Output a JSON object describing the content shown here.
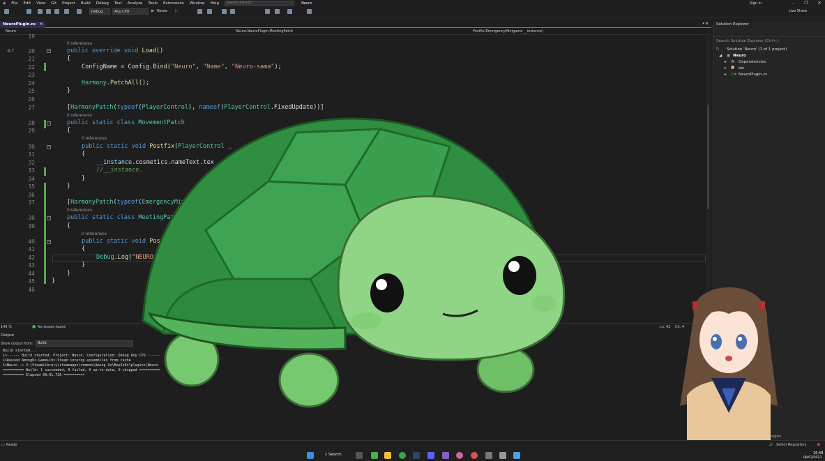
{
  "menubar": {
    "items": [
      "File",
      "Edit",
      "View",
      "Git",
      "Project",
      "Build",
      "Debug",
      "Test",
      "Analyze",
      "Tools",
      "Extensions",
      "Window",
      "Help"
    ],
    "search_placeholder": "Search (Ctrl+Q)",
    "solution_name": "Neuro",
    "sign_in": "Sign in"
  },
  "toolbar": {
    "config": "Debug",
    "platform": "Any CPU",
    "run_label": "Neuro",
    "live_share": "Live Share"
  },
  "document_tab": {
    "label": "NeuroPlugin.cs"
  },
  "navbar": {
    "project": "Neuro",
    "class_path": "Neuro.NeuroPlugin.MeetingPatch",
    "member": "Postfix(EmergencyMinigame __instance)"
  },
  "editor": {
    "line_numbers": [
      "19",
      "20",
      "21",
      "22",
      "23",
      "24",
      "25",
      "26",
      "27",
      "28",
      "29",
      "30",
      "31",
      "32",
      "33",
      "34",
      "35",
      "36",
      "37",
      "38",
      "39",
      "40",
      "41",
      "42",
      "43",
      "44",
      "45",
      "46"
    ],
    "references_label": "0 references",
    "lines": {
      "l20": {
        "kw": "public override void ",
        "me": "Load",
        "rest": "()"
      },
      "l21": "{",
      "l22": {
        "a": "ConfigName = Config.",
        "me": "Bind",
        "b": "(",
        "s1": "\"Neuro\"",
        "c1": ", ",
        "s2": "\"Name\"",
        "c2": ", ",
        "s3": "\"Neuro-sama\"",
        "e": ");"
      },
      "l24": {
        "ty": "Harmony",
        "dot": ".",
        "me": "PatchAll",
        "e": "();"
      },
      "l25": "}",
      "l27": {
        "a": "[",
        "ty1": "HarmonyPatch",
        "b": "(",
        "kw1": "typeof",
        "c": "(",
        "ty2": "PlayerControl",
        "d": "), ",
        "kw2": "nameof",
        "e": "(",
        "ty3": "PlayerControl",
        "f": ".FixedUpdate))]"
      },
      "l28": {
        "kw": "public static class ",
        "ty": "MovementPatch"
      },
      "l29": "{",
      "l30": {
        "kw": "public static void ",
        "me": "Postfix",
        "b": "(",
        "ty": "PlayerControl",
        "rest": " _"
      },
      "l31": "{",
      "l32": {
        "pm": "__instance",
        "rest": ".cosmetics.nameText.tex"
      },
      "l33": "//__instance.",
      "l34": "}",
      "l35": "}",
      "l37": {
        "a": "[",
        "ty1": "HarmonyPatch",
        "b": "(",
        "kw1": "typeof",
        "c": "(",
        "ty2": "EmergencyMin"
      },
      "l38": {
        "kw": "public static class ",
        "ty": "MeetingPatc"
      },
      "l39": "{",
      "l40": {
        "kw": "public static void ",
        "me": "Postf"
      },
      "l41": "{",
      "l42": {
        "ty": "Debug",
        "dot": ".",
        "me": "Log",
        "b": "(",
        "st": "\"NEURO: M"
      },
      "l43": "}",
      "l44": "}",
      "l45": "}"
    }
  },
  "editor_status": {
    "zoom": "146 %",
    "issues": "No issues found",
    "ln": "Ln: 42",
    "ch": "Ch: 4"
  },
  "output": {
    "title": "Output",
    "show_from_label": "Show output from:",
    "source": "Build",
    "lines": [
      "Build started...",
      "1>------ Build started: Project: Neuro, Configuration: Debug Any CPU ------",
      "1>Reused AmongUs.GameLibs.Steam interop assemblies from cache",
      "1>Neuro -> V:\\SteamLibrary\\steamapps\\common\\Among Us\\BepInEx\\plugins\\Neuro",
      "========== Build: 1 succeeded, 0 failed, 0 up-to-date, 0 skipped ==========",
      "========== Elapsed 00:01.726 =========="
    ]
  },
  "solution_explorer": {
    "title": "Solution Explorer",
    "search_placeholder": "Search Solution Explorer (Ctrl+;)",
    "solution": "Solution 'Neuro' (1 of 1 project)",
    "project": "Neuro",
    "items": [
      "Dependencies",
      "bin",
      "NeuroPlugin.cs"
    ]
  },
  "statusbar": {
    "ready": "Ready",
    "repo": "Select Repository",
    "changes": "Changes"
  },
  "taskbar": {
    "search": "Search",
    "time": "16:48",
    "date": "08/03/2023"
  },
  "colors": {
    "accent": "#5a6fd6",
    "turtle_shell": "#3a9a48",
    "turtle_skin": "#8fd585"
  }
}
